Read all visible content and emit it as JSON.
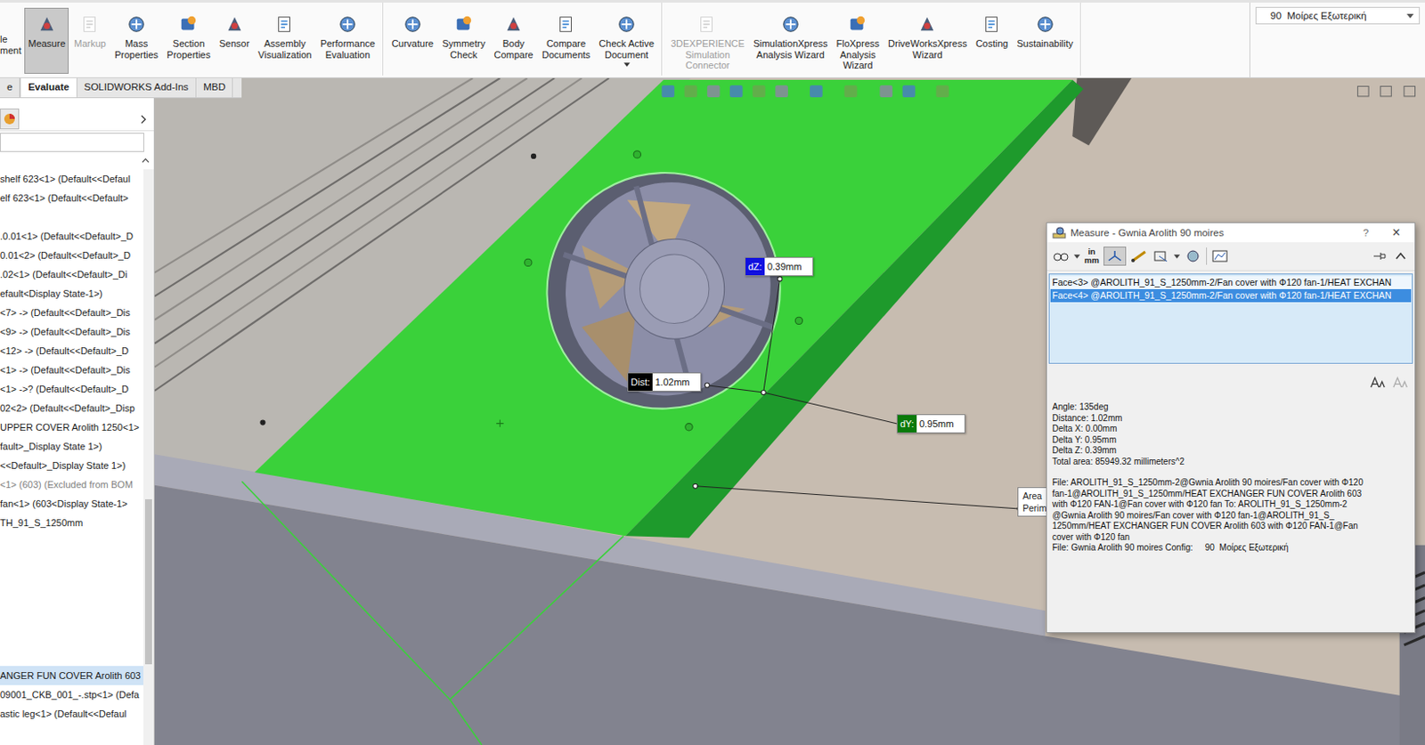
{
  "ribbon": {
    "groups": [
      [
        {
          "kind": "cut",
          "lines": [
            "le",
            "ment"
          ],
          "selected": false,
          "disabled": false,
          "dropdown": false
        },
        {
          "kind": "button",
          "lines": [
            "Measure"
          ],
          "selected": true,
          "disabled": false,
          "dropdown": false
        },
        {
          "kind": "button",
          "lines": [
            "Markup"
          ],
          "selected": false,
          "disabled": true,
          "dropdown": false
        },
        {
          "kind": "button",
          "lines": [
            "Mass",
            "Properties"
          ],
          "selected": false,
          "disabled": false,
          "dropdown": false
        },
        {
          "kind": "button",
          "lines": [
            "Section",
            "Properties"
          ],
          "selected": false,
          "disabled": false,
          "dropdown": false
        },
        {
          "kind": "button",
          "lines": [
            "Sensor"
          ],
          "selected": false,
          "disabled": false,
          "dropdown": false
        },
        {
          "kind": "button",
          "lines": [
            "Assembly",
            "Visualization"
          ],
          "selected": false,
          "disabled": false,
          "dropdown": false
        },
        {
          "kind": "button",
          "lines": [
            "Performance",
            "Evaluation"
          ],
          "selected": false,
          "disabled": false,
          "dropdown": false
        }
      ],
      [
        {
          "kind": "button",
          "lines": [
            "Curvature"
          ],
          "selected": false,
          "disabled": false,
          "dropdown": false
        },
        {
          "kind": "button",
          "lines": [
            "Symmetry",
            "Check"
          ],
          "selected": false,
          "disabled": false,
          "dropdown": false
        },
        {
          "kind": "button",
          "lines": [
            "Body",
            "Compare"
          ],
          "selected": false,
          "disabled": false,
          "dropdown": false
        },
        {
          "kind": "button",
          "lines": [
            "Compare",
            "Documents"
          ],
          "selected": false,
          "disabled": false,
          "dropdown": false
        },
        {
          "kind": "button",
          "lines": [
            "Check Active",
            "Document"
          ],
          "selected": false,
          "disabled": false,
          "dropdown": true
        }
      ],
      [
        {
          "kind": "button",
          "lines": [
            "3DEXPERIENCE",
            "Simulation",
            "Connector"
          ],
          "selected": false,
          "disabled": true,
          "dropdown": false
        },
        {
          "kind": "button",
          "lines": [
            "SimulationXpress",
            "Analysis Wizard"
          ],
          "selected": false,
          "disabled": false,
          "dropdown": false
        },
        {
          "kind": "button",
          "lines": [
            "FloXpress",
            "Analysis",
            "Wizard"
          ],
          "selected": false,
          "disabled": false,
          "dropdown": false
        },
        {
          "kind": "button",
          "lines": [
            "DriveWorksXpress",
            "Wizard"
          ],
          "selected": false,
          "disabled": false,
          "dropdown": false
        },
        {
          "kind": "button",
          "lines": [
            "Costing"
          ],
          "selected": false,
          "disabled": false,
          "dropdown": false
        },
        {
          "kind": "button",
          "lines": [
            "Sustainability"
          ],
          "selected": false,
          "disabled": false,
          "dropdown": false
        }
      ]
    ],
    "config": "90  Μοίρες Εξωτερική"
  },
  "tabs": [
    {
      "label": "e",
      "selected": false
    },
    {
      "label": "Evaluate",
      "selected": true
    },
    {
      "label": "SOLIDWORKS Add-Ins",
      "selected": false
    },
    {
      "label": "MBD",
      "selected": false
    }
  ],
  "feature_tree": {
    "search": {
      "value": ""
    },
    "items": [
      {
        "kind": "row",
        "text": "shelf 623<1> (Default<<Defaul",
        "selected": false,
        "excluded": false
      },
      {
        "kind": "row",
        "text": "elf 623<1> (Default<<Default>",
        "selected": false,
        "excluded": false
      },
      {
        "kind": "blank",
        "text": "",
        "selected": false,
        "excluded": false
      },
      {
        "kind": "row",
        "text": ".0.01<1> (Default<<Default>_D",
        "selected": false,
        "excluded": false
      },
      {
        "kind": "row",
        "text": "0.01<2> (Default<<Default>_D",
        "selected": false,
        "excluded": false
      },
      {
        "kind": "row",
        "text": ".02<1> (Default<<Default>_Di",
        "selected": false,
        "excluded": false
      },
      {
        "kind": "row",
        "text": "efault<Display State-1>)",
        "selected": false,
        "excluded": false
      },
      {
        "kind": "row",
        "text": "<7> -> (Default<<Default>_Dis",
        "selected": false,
        "excluded": false
      },
      {
        "kind": "row",
        "text": "<9> -> (Default<<Default>_Dis",
        "selected": false,
        "excluded": false
      },
      {
        "kind": "row",
        "text": "<12> -> (Default<<Default>_D",
        "selected": false,
        "excluded": false
      },
      {
        "kind": "row",
        "text": "<1> -> (Default<<Default>_Dis",
        "selected": false,
        "excluded": false
      },
      {
        "kind": "row",
        "text": "<1> ->? (Default<<Default>_D",
        "selected": false,
        "excluded": false
      },
      {
        "kind": "row",
        "text": "02<2> (Default<<Default>_Disp",
        "selected": false,
        "excluded": false
      },
      {
        "kind": "row",
        "text": "UPPER COVER Arolith 1250<1>",
        "selected": false,
        "excluded": false
      },
      {
        "kind": "row",
        "text": "fault>_Display State 1>)",
        "selected": false,
        "excluded": false
      },
      {
        "kind": "row",
        "text": "<<Default>_Display State 1>)",
        "selected": false,
        "excluded": false
      },
      {
        "kind": "row",
        "text": "<1> (603) (Excluded from BOM",
        "selected": false,
        "excluded": true
      },
      {
        "kind": "row",
        "text": "fan<1> (603<Display State-1>",
        "selected": false,
        "excluded": false
      },
      {
        "kind": "row",
        "text": "TH_91_S_1250mm",
        "selected": false,
        "excluded": false
      },
      {
        "kind": "blank",
        "text": "",
        "selected": false,
        "excluded": false
      },
      {
        "kind": "blank",
        "text": "",
        "selected": false,
        "excluded": false
      },
      {
        "kind": "blank",
        "text": "",
        "selected": false,
        "excluded": false
      },
      {
        "kind": "blank",
        "text": "",
        "selected": false,
        "excluded": false
      },
      {
        "kind": "blank",
        "text": "",
        "selected": false,
        "excluded": false
      },
      {
        "kind": "blank",
        "text": "",
        "selected": false,
        "excluded": false
      },
      {
        "kind": "blank",
        "text": "",
        "selected": false,
        "excluded": false
      },
      {
        "kind": "row",
        "text": "ANGER FUN COVER Arolith 603",
        "selected": true,
        "excluded": false
      },
      {
        "kind": "row",
        "text": "09001_CKB_001_-.stp<1> (Defa",
        "selected": false,
        "excluded": false
      },
      {
        "kind": "row",
        "text": "astic leg<1> (Default<<Defaul",
        "selected": false,
        "excluded": false
      }
    ]
  },
  "viewport": {
    "annotations": [
      {
        "label": "dZ:",
        "value": "0.39mm",
        "color": "#1010e0"
      },
      {
        "label": "Dist:",
        "value": "1.02mm",
        "color": "#000000"
      },
      {
        "label": "dY:",
        "value": "0.95mm",
        "color": "#0a7a0a"
      }
    ],
    "area_callout": [
      "Area",
      "Perim"
    ]
  },
  "measure_dialog": {
    "title": "Measure - Gwnia Arolith 90 moires",
    "help": "?",
    "close": "×",
    "units": [
      "in",
      "mm"
    ],
    "selections": [
      {
        "text": "Face<3> @AROLITH_91_S_1250mm-2/Fan cover with Φ120 fan-1/HEAT EXCHAN",
        "selected": false
      },
      {
        "text": "Face<4> @AROLITH_91_S_1250mm-2/Fan cover with Φ120 fan-1/HEAT EXCHAN",
        "selected": true
      }
    ],
    "results": [
      "Angle: 135deg",
      "Distance: 1.02mm",
      "Delta X: 0.00mm",
      "Delta Y: 0.95mm",
      "Delta Z: 0.39mm",
      "Total area: 85949.32 millimeters^2"
    ],
    "file_lines": [
      "File: AROLITH_91_S_1250mm-2@Gwnia Arolith 90 moires/Fan cover with Φ120",
      "fan-1@AROLITH_91_S_1250mm/HEAT EXCHANGER FUN COVER Arolith 603",
      "with Φ120 FAN-1@Fan cover with Φ120 fan To: AROLITH_91_S_1250mm-2",
      "@Gwnia Arolith 90 moires/Fan cover with Φ120 fan-1@AROLITH_91_S_",
      "1250mm/HEAT EXCHANGER FUN COVER Arolith 603 with Φ120 FAN-1@Fan",
      "cover with Φ120 fan",
      "File: Gwnia Arolith 90 moires Config:     90  Μοίρες Εξωτερική"
    ]
  }
}
